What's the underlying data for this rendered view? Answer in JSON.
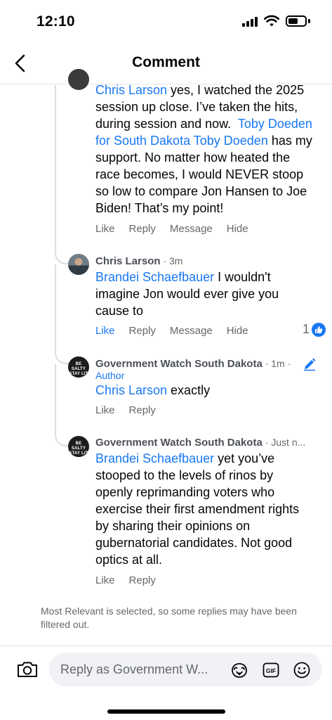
{
  "status_bar": {
    "time": "12:10"
  },
  "header": {
    "title": "Comment"
  },
  "comments": [
    {
      "lines": [
        [
          {
            "t": "Chris Larson",
            "m": true
          },
          {
            "t": " yes, I watched the 2025"
          }
        ],
        [
          {
            "t": "session up close. I’ve taken the hits,"
          }
        ],
        [
          {
            "t": "during session and now.  "
          },
          {
            "t": "Toby Doeden",
            "m": true
          }
        ],
        [
          {
            "t": "for South Dakota Toby Doeden",
            "m": true
          },
          {
            "t": " has my"
          }
        ],
        [
          {
            "t": "support. No matter how heated the"
          }
        ],
        [
          {
            "t": "race becomes, I would NEVER stoop"
          }
        ],
        [
          {
            "t": "so low to compare Jon Hansen to Joe"
          }
        ],
        [
          {
            "t": "Biden! That’s my point!"
          }
        ]
      ],
      "actions": [
        "Like",
        "Reply",
        "Message",
        "Hide"
      ]
    },
    {
      "author": "Chris Larson",
      "meta": " · 3m",
      "lines": [
        [
          {
            "t": "Brandei Schaefbauer",
            "m": true
          },
          {
            "t": " I wouldn't"
          }
        ],
        [
          {
            "t": "imagine Jon would ever give you"
          }
        ],
        [
          {
            "t": "cause to"
          }
        ]
      ],
      "actions": [
        "Like",
        "Reply",
        "Message",
        "Hide"
      ],
      "like_count": "1"
    },
    {
      "author": "Government Watch South Dakota",
      "meta": " · 1m ·",
      "badge": "Author",
      "avatar_text": "BE SALTY STAY LIT",
      "lines": [
        [
          {
            "t": "Chris Larson",
            "m": true
          },
          {
            "t": " exactly"
          }
        ]
      ],
      "actions": [
        "Like",
        "Reply"
      ]
    },
    {
      "author": "Government Watch South Dakota",
      "meta": " · Just n...",
      "avatar_text": "BE SALTY STAY LIT",
      "lines": [
        [
          {
            "t": "Brandei Schaefbauer",
            "m": true
          },
          {
            "t": " yet you’ve"
          }
        ],
        [
          {
            "t": "stooped to the levels of rinos by"
          }
        ],
        [
          {
            "t": "openly reprimanding voters who"
          }
        ],
        [
          {
            "t": "exercise their first amendment rights"
          }
        ],
        [
          {
            "t": "by sharing their opinions on"
          }
        ],
        [
          {
            "t": "gubernatorial candidates. Not good"
          }
        ],
        [
          {
            "t": "optics at all."
          }
        ]
      ],
      "actions": [
        "Like",
        "Reply"
      ]
    }
  ],
  "filter_note": "Most Relevant is selected, so some replies may have been filtered out.",
  "reply_bar": {
    "placeholder": "Reply as Government W...",
    "icons": [
      "camera-icon",
      "avatar-sticker-icon",
      "gif-icon",
      "emoji-icon"
    ]
  },
  "colors": {
    "link": "#1877f2",
    "muted": "#65676b",
    "thread": "#dadde1"
  }
}
